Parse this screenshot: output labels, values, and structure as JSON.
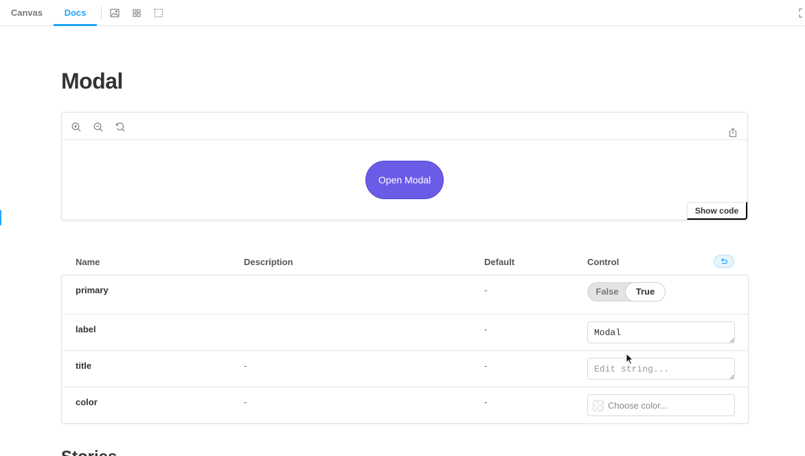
{
  "toolbar": {
    "tabs": [
      {
        "label": "Canvas",
        "active": false
      },
      {
        "label": "Docs",
        "active": true
      }
    ],
    "icons": [
      "image-icon",
      "grid-icon",
      "outline-icon"
    ],
    "fullscreen_icon": "expand-icon"
  },
  "page": {
    "title": "Modal"
  },
  "preview": {
    "zoom_icons": [
      "zoom-in-icon",
      "zoom-out-icon",
      "zoom-reset-icon"
    ],
    "share_icon": "share-icon",
    "primary_button_label": "Open Modal",
    "show_code_label": "Show code",
    "accent_color": "#6b5ce7"
  },
  "args_table": {
    "headers": {
      "name": "Name",
      "description": "Description",
      "default": "Default",
      "control": "Control"
    },
    "reset_icon": "undo-icon",
    "rows": [
      {
        "name": "primary",
        "description": "",
        "default": "-",
        "control": {
          "type": "boolean",
          "false_label": "False",
          "true_label": "True",
          "value": true
        }
      },
      {
        "name": "label",
        "description": "",
        "default": "-",
        "control": {
          "type": "text",
          "value": "Modal",
          "placeholder": "Edit string..."
        }
      },
      {
        "name": "title",
        "description": "-",
        "default": "-",
        "control": {
          "type": "text",
          "value": "",
          "placeholder": "Edit string..."
        }
      },
      {
        "name": "color",
        "description": "-",
        "default": "-",
        "control": {
          "type": "color",
          "placeholder": "Choose color..."
        }
      }
    ]
  },
  "stories": {
    "heading": "Stories"
  },
  "brand_color": "#1ea7fd"
}
